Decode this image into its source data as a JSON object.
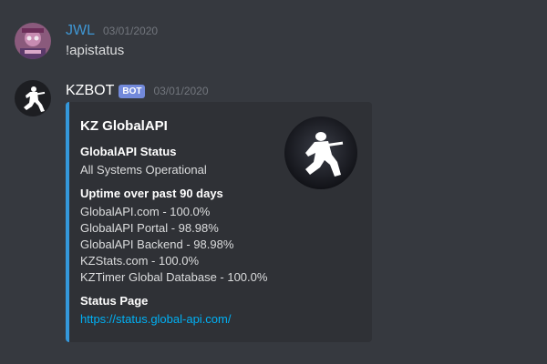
{
  "messages": [
    {
      "username": "JWL",
      "username_color": "#3f96d3",
      "timestamp": "03/01/2020",
      "content": "!apistatus",
      "avatar_icon": "user-avatar-icon"
    },
    {
      "username": "KZBOT",
      "username_color": "#ffffff",
      "bot_tag": "BOT",
      "timestamp": "03/01/2020",
      "avatar_icon": "soldier-avatar-icon",
      "embed": {
        "accent_color": "#3498db",
        "title": "KZ GlobalAPI",
        "thumbnail_icon": "soldier-silhouette-icon",
        "fields": [
          {
            "name": "GlobalAPI Status",
            "lines": [
              "All Systems Operational"
            ]
          },
          {
            "name": "Uptime over past 90 days",
            "lines": [
              "GlobalAPI.com - 100.0%",
              "GlobalAPI Portal - 98.98%",
              "GlobalAPI Backend - 98.98%",
              "KZStats.com - 100.0%",
              "KZTimer Global Database - 100.0%"
            ]
          },
          {
            "name": "Status Page",
            "link": "https://status.global-api.com/"
          }
        ]
      }
    }
  ]
}
